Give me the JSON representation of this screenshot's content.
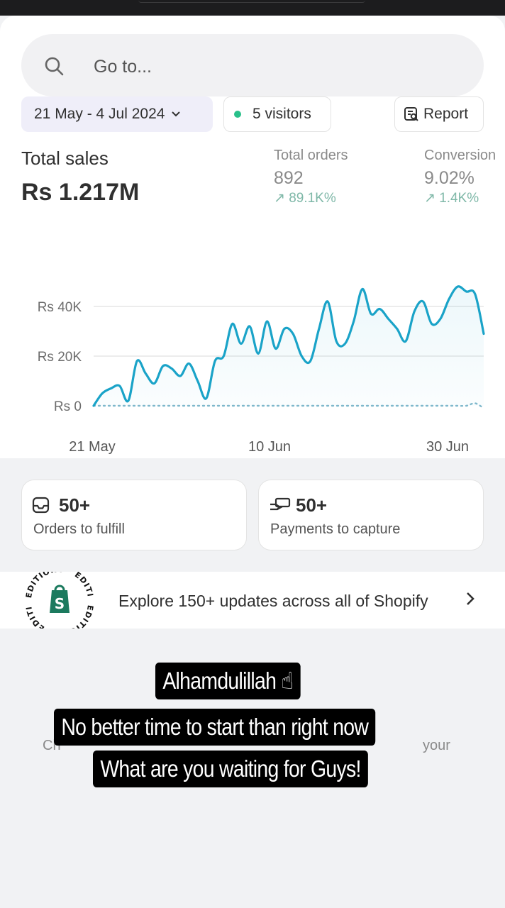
{
  "search": {
    "placeholder": "Go to..."
  },
  "filters": {
    "date_range": "21 May - 4 Jul 2024",
    "visitors": "5 visitors",
    "report": "Report"
  },
  "summary": {
    "total_sales_label": "Total sales",
    "total_sales_value": "Rs 1.217M",
    "total_orders_label": "Total orders",
    "total_orders_value": "892",
    "total_orders_change": "↗ 89.1K%",
    "conversion_label": "Conversion",
    "conversion_value": "9.02%",
    "conversion_change": "↗ 1.4K%"
  },
  "chart_data": {
    "type": "line",
    "y_ticks": [
      "Rs 40K",
      "Rs 20K",
      "Rs 0"
    ],
    "x_ticks": [
      "21 May",
      "10 Jun",
      "30 Jun"
    ],
    "ylim": [
      0,
      50000
    ],
    "colors": {
      "current": "#1aa3c8",
      "comparison": "#7fb8cc"
    },
    "series": [
      {
        "values": [
          0,
          5000,
          7000,
          8000,
          2000,
          18000,
          13000,
          9000,
          16000,
          15000,
          12000,
          17000,
          10000,
          3000,
          18000,
          20000,
          33000,
          25000,
          32000,
          21000,
          34000,
          23000,
          31000,
          29000,
          20000,
          18000,
          31000,
          42000,
          26000,
          25000,
          34000,
          47000,
          37000,
          39000,
          35000,
          31000,
          26000,
          38000,
          42000,
          33000,
          35000,
          43000,
          48000,
          46000,
          45000,
          29000
        ]
      },
      {
        "values": [
          0,
          0,
          0,
          0,
          0,
          0,
          0,
          0,
          0,
          0,
          0,
          0,
          0,
          0,
          0,
          0,
          0,
          0,
          0,
          0,
          0,
          0,
          0,
          0,
          0,
          0,
          0,
          0,
          0,
          0,
          0,
          0,
          0,
          0,
          0,
          0,
          0,
          0,
          0,
          0,
          0,
          0,
          0,
          0,
          1000,
          -1000
        ]
      }
    ]
  },
  "tasks": [
    {
      "count": "50+",
      "label": "Orders to fulfill",
      "icon": "inbox-icon"
    },
    {
      "count": "50+",
      "label": "Payments to capture",
      "icon": "cash-hand-icon"
    }
  ],
  "editions": {
    "badge_text": "EDITIONS",
    "text": "Explore 150+ updates across all of Shopify"
  },
  "behind_text": {
    "left": "Ch",
    "right": "your"
  },
  "captions": [
    "Alhamdulillah ☝",
    "No better time to start than right now",
    "What are you waiting for Guys!"
  ]
}
